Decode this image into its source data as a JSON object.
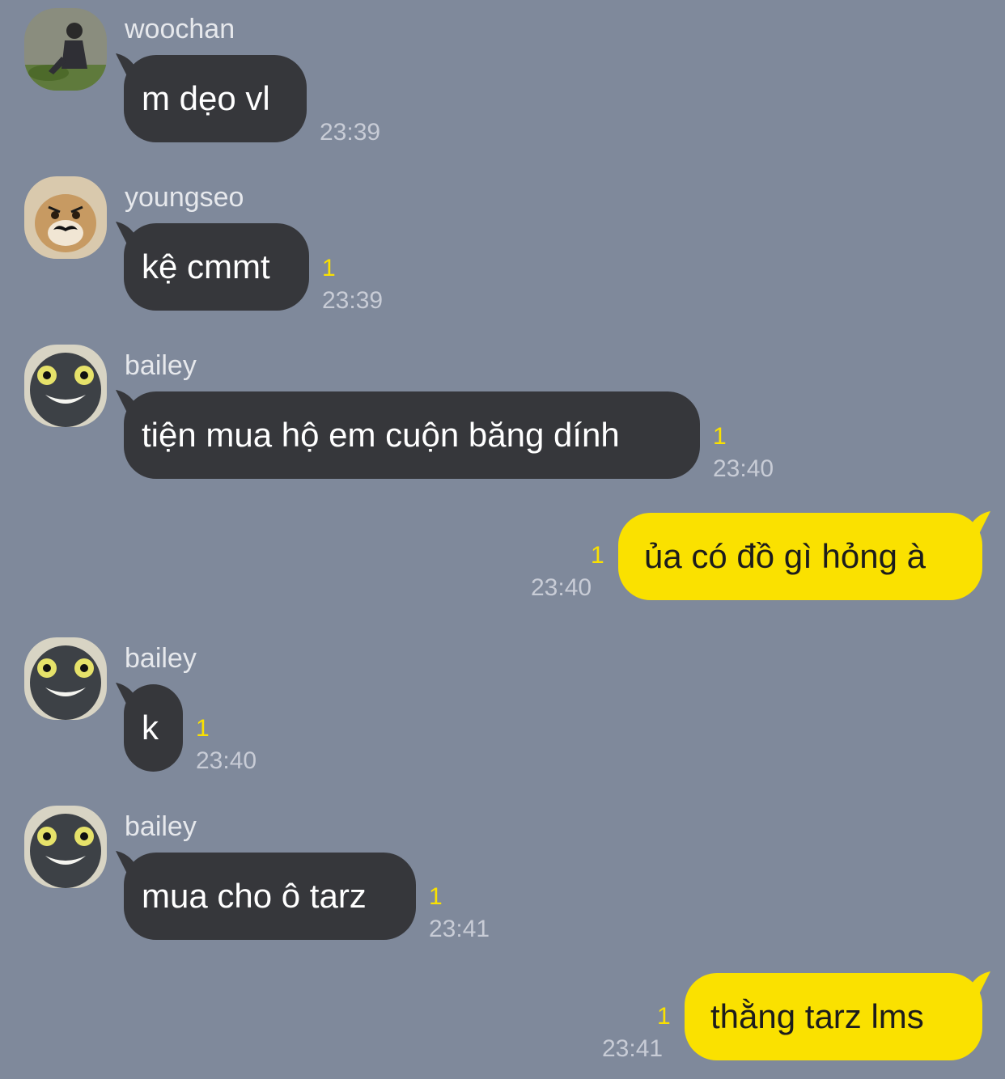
{
  "theme": {
    "background": "#7f899b",
    "incoming_bubble": "#36373b",
    "outgoing_bubble": "#fae100",
    "unread_color": "#fae100"
  },
  "messages": [
    {
      "direction": "incoming",
      "sender": "woochan",
      "avatar": "man-sitting-on-rock-avatar",
      "text": "m dẹo vl",
      "unread": "",
      "time": "23:39"
    },
    {
      "direction": "incoming",
      "sender": "youngseo",
      "avatar": "kitten-with-mustache-avatar",
      "text": "kệ cmmt",
      "unread": "1",
      "time": "23:39"
    },
    {
      "direction": "incoming",
      "sender": "bailey",
      "avatar": "grinning-creature-avatar",
      "text": "tiện mua hộ em cuộn băng dính",
      "unread": "1",
      "time": "23:40"
    },
    {
      "direction": "outgoing",
      "sender": "",
      "avatar": "",
      "text": "ủa có đồ gì hỏng à",
      "unread": "1",
      "time": "23:40"
    },
    {
      "direction": "incoming",
      "sender": "bailey",
      "avatar": "grinning-creature-avatar",
      "text": "k",
      "unread": "1",
      "time": "23:40"
    },
    {
      "direction": "incoming",
      "sender": "bailey",
      "avatar": "grinning-creature-avatar",
      "text": "mua cho ô tarz",
      "unread": "1",
      "time": "23:41"
    },
    {
      "direction": "outgoing",
      "sender": "",
      "avatar": "",
      "text": "thằng tarz lms",
      "unread": "1",
      "time": "23:41"
    }
  ]
}
